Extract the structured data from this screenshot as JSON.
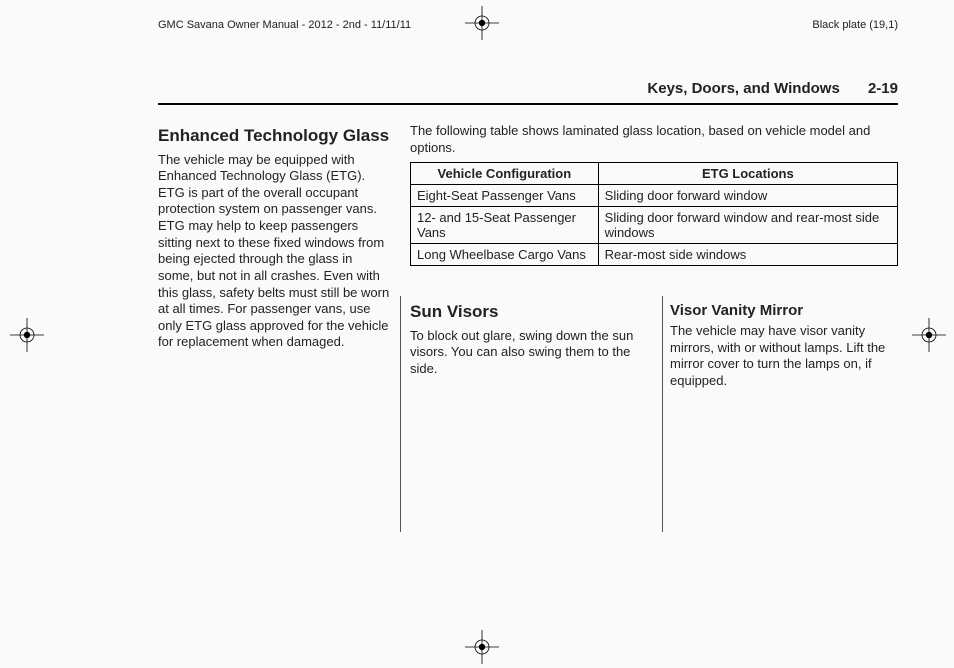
{
  "header": {
    "doc_id": "GMC Savana Owner Manual - 2012 - 2nd - 11/11/11",
    "plate": "Black plate (19,1)"
  },
  "running_head": {
    "section_title": "Keys, Doors, and Windows",
    "page_number": "2-19"
  },
  "col1": {
    "heading": "Enhanced Technology Glass",
    "body": "The vehicle may be equipped with Enhanced Technology Glass (ETG). ETG is part of the overall occupant protection system on passenger vans. ETG may help to keep passengers sitting next to these fixed windows from being ejected through the glass in some, but not in all crashes. Even with this glass, safety belts must still be worn at all times. For passenger vans, use only ETG glass approved for the vehicle for replacement when damaged."
  },
  "col23_top": {
    "lead_in": "The following table shows laminated glass location, based on vehicle model and options.",
    "table": {
      "head": [
        "Vehicle Configuration",
        "ETG Locations"
      ],
      "rows": [
        [
          "Eight-Seat Passenger Vans",
          "Sliding door forward window"
        ],
        [
          "12- and 15-Seat Passenger Vans",
          "Sliding door forward window and rear-most side windows"
        ],
        [
          "Long Wheelbase Cargo Vans",
          "Rear-most side windows"
        ]
      ]
    }
  },
  "col2": {
    "heading": "Sun Visors",
    "body": "To block out glare, swing down the sun visors. You can also swing them to the side."
  },
  "col3": {
    "heading": "Visor Vanity Mirror",
    "body": "The vehicle may have visor vanity mirrors, with or without lamps. Lift the mirror cover to turn the lamps on, if equipped."
  }
}
